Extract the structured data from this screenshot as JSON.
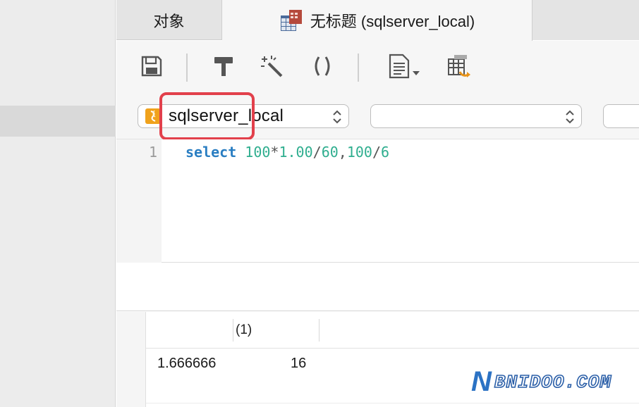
{
  "tabs": {
    "objects_label": "对象",
    "query_label": "无标题 (sqlserver_local)"
  },
  "selectors": {
    "connection": "sqlserver_local",
    "database": "",
    "schema": ""
  },
  "editor": {
    "line_number": "1",
    "tokens": {
      "keyword": "select",
      "n1": "100",
      "op1": "*",
      "n2": "1.00",
      "op2": "/",
      "n3": "60",
      "comma": ",",
      "n4": "100",
      "op3": "/",
      "n5": "6"
    }
  },
  "results": {
    "columns": [
      "",
      "(1)"
    ],
    "rows": [
      [
        "1.666666",
        "16"
      ]
    ]
  },
  "watermark": {
    "letter": "N",
    "text": "BNIDOO.COM"
  },
  "colors": {
    "highlight": "#e2404b",
    "keyword": "#2a7ec2",
    "number": "#2fae8f"
  },
  "icons": {
    "save": "save-icon",
    "build": "hammer-icon",
    "beautify": "magic-wand-icon",
    "parentheses": "parentheses-icon",
    "code_snippet": "document-icon",
    "export": "table-export-icon"
  }
}
